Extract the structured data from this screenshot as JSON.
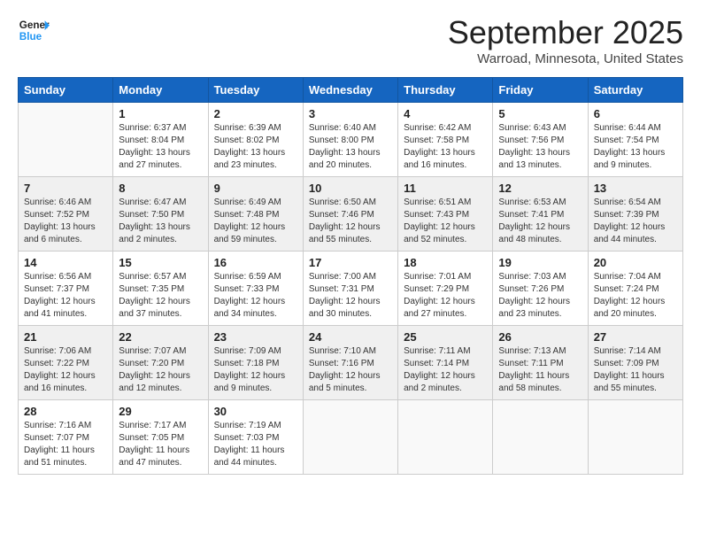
{
  "logo": {
    "line1": "General",
    "line2": "Blue"
  },
  "title": "September 2025",
  "location": "Warroad, Minnesota, United States",
  "weekdays": [
    "Sunday",
    "Monday",
    "Tuesday",
    "Wednesday",
    "Thursday",
    "Friday",
    "Saturday"
  ],
  "weeks": [
    [
      {
        "day": "",
        "info": ""
      },
      {
        "day": "1",
        "info": "Sunrise: 6:37 AM\nSunset: 8:04 PM\nDaylight: 13 hours\nand 27 minutes."
      },
      {
        "day": "2",
        "info": "Sunrise: 6:39 AM\nSunset: 8:02 PM\nDaylight: 13 hours\nand 23 minutes."
      },
      {
        "day": "3",
        "info": "Sunrise: 6:40 AM\nSunset: 8:00 PM\nDaylight: 13 hours\nand 20 minutes."
      },
      {
        "day": "4",
        "info": "Sunrise: 6:42 AM\nSunset: 7:58 PM\nDaylight: 13 hours\nand 16 minutes."
      },
      {
        "day": "5",
        "info": "Sunrise: 6:43 AM\nSunset: 7:56 PM\nDaylight: 13 hours\nand 13 minutes."
      },
      {
        "day": "6",
        "info": "Sunrise: 6:44 AM\nSunset: 7:54 PM\nDaylight: 13 hours\nand 9 minutes."
      }
    ],
    [
      {
        "day": "7",
        "info": "Sunrise: 6:46 AM\nSunset: 7:52 PM\nDaylight: 13 hours\nand 6 minutes."
      },
      {
        "day": "8",
        "info": "Sunrise: 6:47 AM\nSunset: 7:50 PM\nDaylight: 13 hours\nand 2 minutes."
      },
      {
        "day": "9",
        "info": "Sunrise: 6:49 AM\nSunset: 7:48 PM\nDaylight: 12 hours\nand 59 minutes."
      },
      {
        "day": "10",
        "info": "Sunrise: 6:50 AM\nSunset: 7:46 PM\nDaylight: 12 hours\nand 55 minutes."
      },
      {
        "day": "11",
        "info": "Sunrise: 6:51 AM\nSunset: 7:43 PM\nDaylight: 12 hours\nand 52 minutes."
      },
      {
        "day": "12",
        "info": "Sunrise: 6:53 AM\nSunset: 7:41 PM\nDaylight: 12 hours\nand 48 minutes."
      },
      {
        "day": "13",
        "info": "Sunrise: 6:54 AM\nSunset: 7:39 PM\nDaylight: 12 hours\nand 44 minutes."
      }
    ],
    [
      {
        "day": "14",
        "info": "Sunrise: 6:56 AM\nSunset: 7:37 PM\nDaylight: 12 hours\nand 41 minutes."
      },
      {
        "day": "15",
        "info": "Sunrise: 6:57 AM\nSunset: 7:35 PM\nDaylight: 12 hours\nand 37 minutes."
      },
      {
        "day": "16",
        "info": "Sunrise: 6:59 AM\nSunset: 7:33 PM\nDaylight: 12 hours\nand 34 minutes."
      },
      {
        "day": "17",
        "info": "Sunrise: 7:00 AM\nSunset: 7:31 PM\nDaylight: 12 hours\nand 30 minutes."
      },
      {
        "day": "18",
        "info": "Sunrise: 7:01 AM\nSunset: 7:29 PM\nDaylight: 12 hours\nand 27 minutes."
      },
      {
        "day": "19",
        "info": "Sunrise: 7:03 AM\nSunset: 7:26 PM\nDaylight: 12 hours\nand 23 minutes."
      },
      {
        "day": "20",
        "info": "Sunrise: 7:04 AM\nSunset: 7:24 PM\nDaylight: 12 hours\nand 20 minutes."
      }
    ],
    [
      {
        "day": "21",
        "info": "Sunrise: 7:06 AM\nSunset: 7:22 PM\nDaylight: 12 hours\nand 16 minutes."
      },
      {
        "day": "22",
        "info": "Sunrise: 7:07 AM\nSunset: 7:20 PM\nDaylight: 12 hours\nand 12 minutes."
      },
      {
        "day": "23",
        "info": "Sunrise: 7:09 AM\nSunset: 7:18 PM\nDaylight: 12 hours\nand 9 minutes."
      },
      {
        "day": "24",
        "info": "Sunrise: 7:10 AM\nSunset: 7:16 PM\nDaylight: 12 hours\nand 5 minutes."
      },
      {
        "day": "25",
        "info": "Sunrise: 7:11 AM\nSunset: 7:14 PM\nDaylight: 12 hours\nand 2 minutes."
      },
      {
        "day": "26",
        "info": "Sunrise: 7:13 AM\nSunset: 7:11 PM\nDaylight: 11 hours\nand 58 minutes."
      },
      {
        "day": "27",
        "info": "Sunrise: 7:14 AM\nSunset: 7:09 PM\nDaylight: 11 hours\nand 55 minutes."
      }
    ],
    [
      {
        "day": "28",
        "info": "Sunrise: 7:16 AM\nSunset: 7:07 PM\nDaylight: 11 hours\nand 51 minutes."
      },
      {
        "day": "29",
        "info": "Sunrise: 7:17 AM\nSunset: 7:05 PM\nDaylight: 11 hours\nand 47 minutes."
      },
      {
        "day": "30",
        "info": "Sunrise: 7:19 AM\nSunset: 7:03 PM\nDaylight: 11 hours\nand 44 minutes."
      },
      {
        "day": "",
        "info": ""
      },
      {
        "day": "",
        "info": ""
      },
      {
        "day": "",
        "info": ""
      },
      {
        "day": "",
        "info": ""
      }
    ]
  ]
}
